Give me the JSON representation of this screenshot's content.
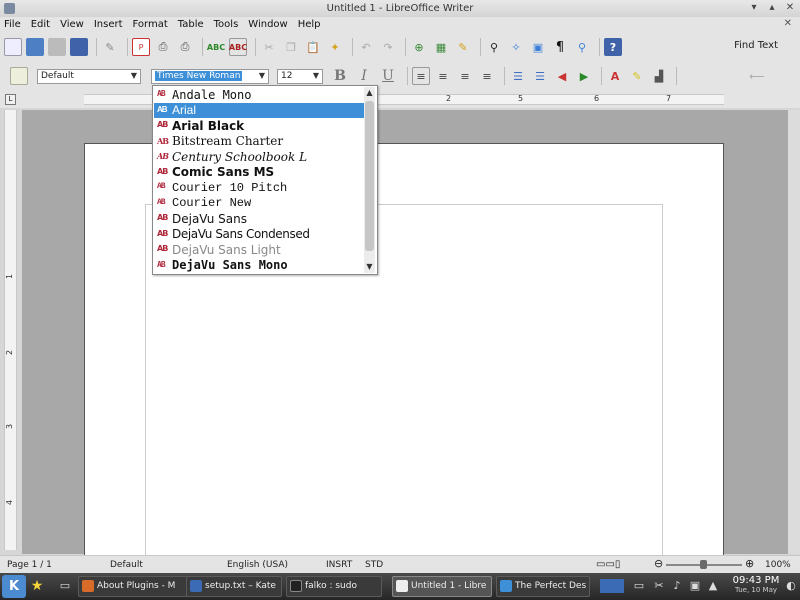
{
  "window": {
    "title": "Untitled 1 - LibreOffice Writer"
  },
  "menu": [
    "File",
    "Edit",
    "View",
    "Insert",
    "Format",
    "Table",
    "Tools",
    "Window",
    "Help"
  ],
  "toolbar": {
    "find_label": "Find Text"
  },
  "format_bar": {
    "style": "Default",
    "font": "Times New Roman",
    "size": "12"
  },
  "ruler": {
    "h_numbers": [
      "1",
      "2",
      "3",
      "4",
      "5",
      "6",
      "7"
    ],
    "v_numbers": [
      "1",
      "2",
      "3",
      "4"
    ]
  },
  "font_list": [
    {
      "label": "Andale Mono",
      "selected": false
    },
    {
      "label": "Arial",
      "selected": true
    },
    {
      "label": "Arial Black",
      "selected": false
    },
    {
      "label": "Bitstream Charter",
      "selected": false
    },
    {
      "label": "Century Schoolbook L",
      "selected": false
    },
    {
      "label": "Comic Sans MS",
      "selected": false
    },
    {
      "label": "Courier 10 Pitch",
      "selected": false
    },
    {
      "label": "Courier New",
      "selected": false
    },
    {
      "label": "DejaVu Sans",
      "selected": false
    },
    {
      "label": "DejaVu Sans Condensed",
      "selected": false
    },
    {
      "label": "DejaVu Sans Light",
      "selected": false
    },
    {
      "label": "DejaVu Sans Mono",
      "selected": false
    }
  ],
  "status": {
    "page": "Page 1 / 1",
    "style": "Default",
    "language": "English (USA)",
    "insert": "INSRT",
    "selection": "STD",
    "zoom": "100%"
  },
  "taskbar": {
    "tasks": [
      {
        "label": "About Plugins - M"
      },
      {
        "label": "setup.txt – Kate"
      },
      {
        "label": "falko : sudo"
      },
      {
        "label": "Untitled 1 - Libre"
      },
      {
        "label": "The Perfect Des"
      }
    ],
    "time": "09:43 PM",
    "date": "Tue, 10 May"
  },
  "colors": {
    "selection": "#3d8fd8",
    "taskbar": "#2f2f2f"
  }
}
